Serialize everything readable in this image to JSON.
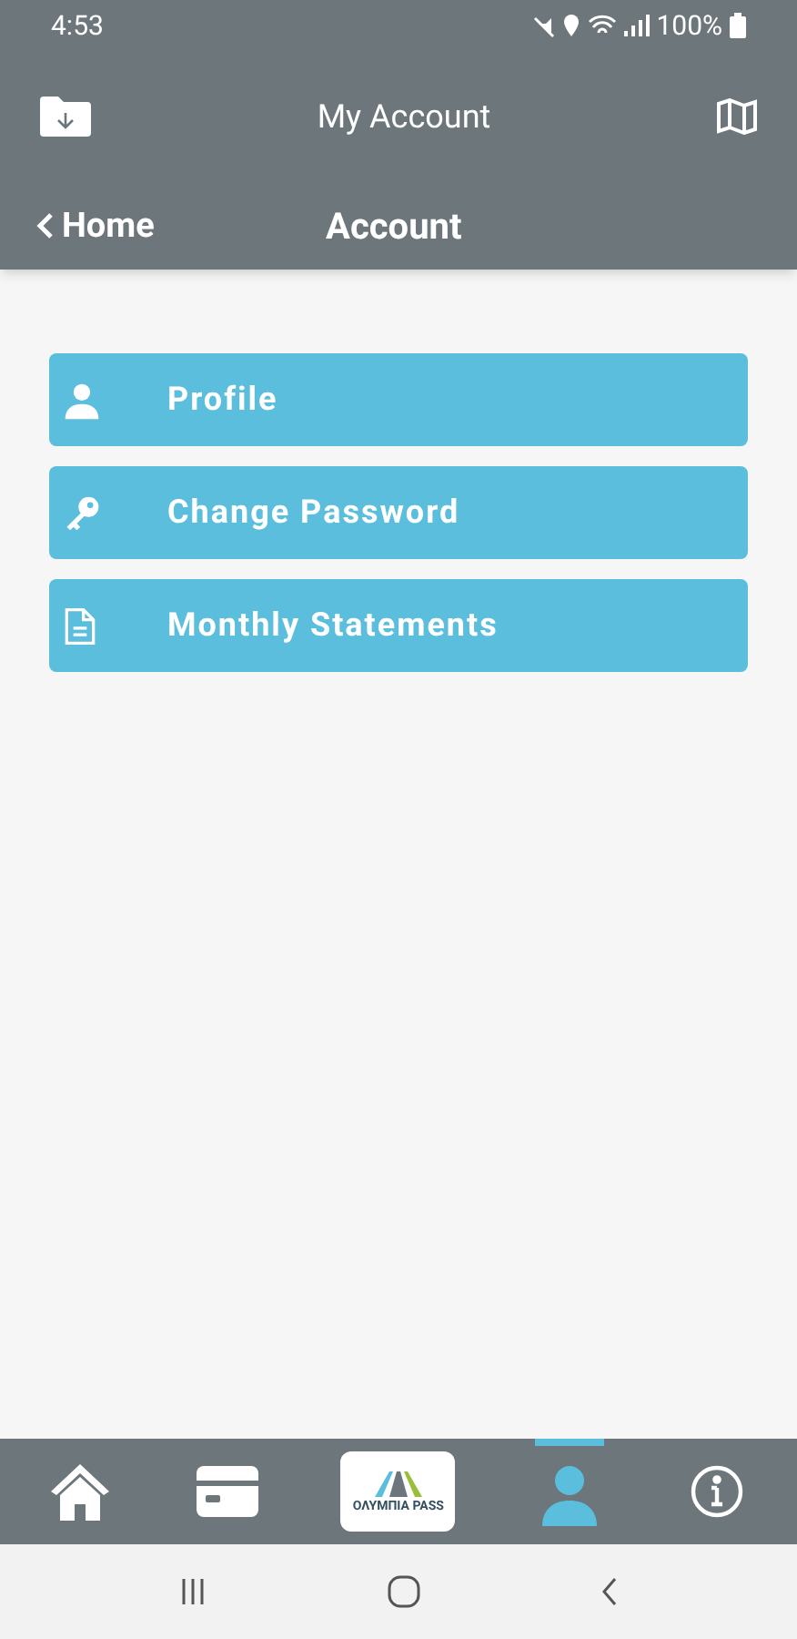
{
  "status_bar": {
    "time": "4:53",
    "battery": "100%"
  },
  "header": {
    "title": "My Account"
  },
  "subheader": {
    "back": "Home",
    "title": "Account"
  },
  "menu": [
    {
      "kind": "profile",
      "label": "Profile"
    },
    {
      "kind": "password",
      "label": "Change Password"
    },
    {
      "kind": "statements",
      "label": "Monthly Statements"
    }
  ],
  "tab_bar": [
    {
      "kind": "home",
      "selected": false
    },
    {
      "kind": "card",
      "selected": false
    },
    {
      "kind": "logo",
      "label": "ΟΛΥΜΠΙΑ PASS",
      "selected": false
    },
    {
      "kind": "account",
      "selected": true
    },
    {
      "kind": "info",
      "selected": false
    }
  ]
}
